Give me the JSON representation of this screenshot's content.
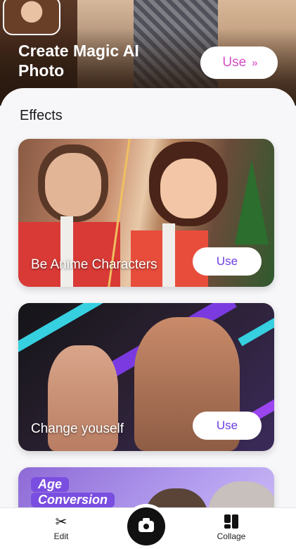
{
  "hero": {
    "title": "Create Magic AI Photo",
    "use_label": "Use",
    "chevron": "»"
  },
  "effects": {
    "section_title": "Effects",
    "cards": [
      {
        "label": "Be Anime Characters",
        "button": "Use"
      },
      {
        "label": "Change youself",
        "button": "Use"
      },
      {
        "badge_line1": "Age",
        "badge_line2": "Conversion"
      }
    ]
  },
  "nav": {
    "edit_label": "Edit",
    "edit_icon": "scissors-icon",
    "camera_icon": "camera-icon",
    "collage_label": "Collage",
    "collage_icon": "collage-icon"
  },
  "colors": {
    "accent_pink": "#d64fc5",
    "accent_purple": "#6b3de0"
  }
}
